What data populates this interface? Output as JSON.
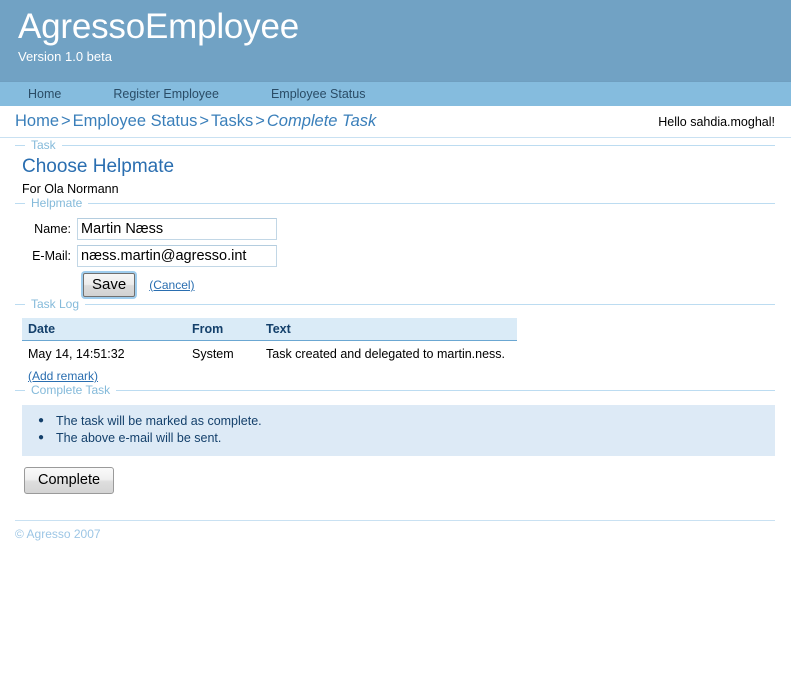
{
  "header": {
    "app_title": "AgressoEmployee",
    "version": "Version 1.0 beta",
    "banner_color": "#71a2c4",
    "nav_color": "#85bcde"
  },
  "nav": {
    "items": [
      {
        "label": "Home"
      },
      {
        "label": "Register Employee"
      },
      {
        "label": "Employee Status"
      }
    ]
  },
  "breadcrumb": {
    "items": [
      {
        "label": "Home"
      },
      {
        "label": "Employee Status"
      },
      {
        "label": "Tasks"
      }
    ],
    "separator": ">",
    "current": "Complete Task"
  },
  "user": {
    "greeting": "Hello sahdia.moghal!"
  },
  "task_section": {
    "legend": "Task",
    "title": "Choose Helpmate",
    "subtitle": "For Ola Normann"
  },
  "helpmate_section": {
    "legend": "Helpmate",
    "name_label": "Name:",
    "name_value": "Martin Næss",
    "email_label": "E-Mail:",
    "email_value": "næss.martin@agresso.int",
    "save_label": "Save",
    "cancel_label": "(Cancel)"
  },
  "task_log": {
    "legend": "Task Log",
    "columns": [
      "Date",
      "From",
      "Text"
    ],
    "rows": [
      {
        "date": "May 14, 14:51:32",
        "from": "System",
        "text": "Task created and delegated to martin.ness."
      }
    ],
    "add_remark_label": "(Add remark)"
  },
  "complete_section": {
    "legend": "Complete Task",
    "notices": [
      "The task will be marked as complete.",
      "The above e-mail will be sent."
    ],
    "complete_label": "Complete"
  },
  "footer": {
    "copyright": "© Agresso 2007"
  }
}
